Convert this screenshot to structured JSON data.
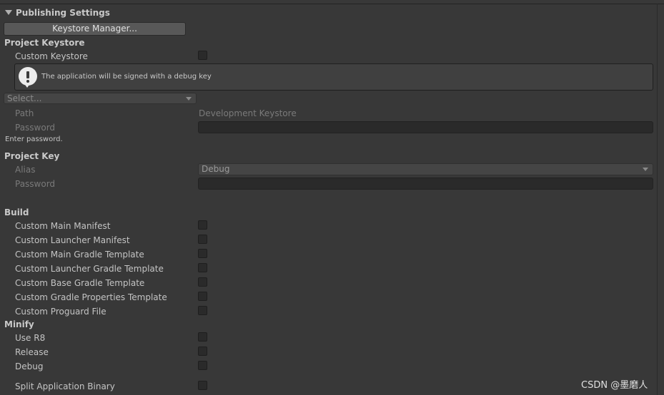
{
  "section": {
    "title": "Publishing Settings"
  },
  "keystore_manager_button": "Keystore Manager...",
  "project_keystore": {
    "heading": "Project Keystore",
    "custom_keystore_label": "Custom Keystore",
    "custom_keystore_checked": false,
    "help_message": "The application will be signed with a debug key",
    "select_value": "Select...",
    "path_label": "Path",
    "path_value": "Development Keystore",
    "password_label": "Password",
    "password_hint": "Enter password."
  },
  "project_key": {
    "heading": "Project Key",
    "alias_label": "Alias",
    "alias_value": "Debug",
    "password_label": "Password"
  },
  "build": {
    "heading": "Build",
    "items": [
      {
        "label": "Custom Main Manifest",
        "checked": false
      },
      {
        "label": "Custom Launcher Manifest",
        "checked": false
      },
      {
        "label": "Custom Main Gradle Template",
        "checked": false
      },
      {
        "label": "Custom Launcher Gradle Template",
        "checked": false
      },
      {
        "label": "Custom Base Gradle Template",
        "checked": false
      },
      {
        "label": "Custom Gradle Properties Template",
        "checked": false
      },
      {
        "label": "Custom Proguard File",
        "checked": false
      }
    ]
  },
  "minify": {
    "heading": "Minify",
    "items": [
      {
        "label": "Use R8",
        "checked": false
      },
      {
        "label": "Release",
        "checked": false
      },
      {
        "label": "Debug",
        "checked": false
      }
    ]
  },
  "split_binary": {
    "label": "Split Application Binary",
    "checked": false
  },
  "watermark": "CSDN @墨磨人"
}
